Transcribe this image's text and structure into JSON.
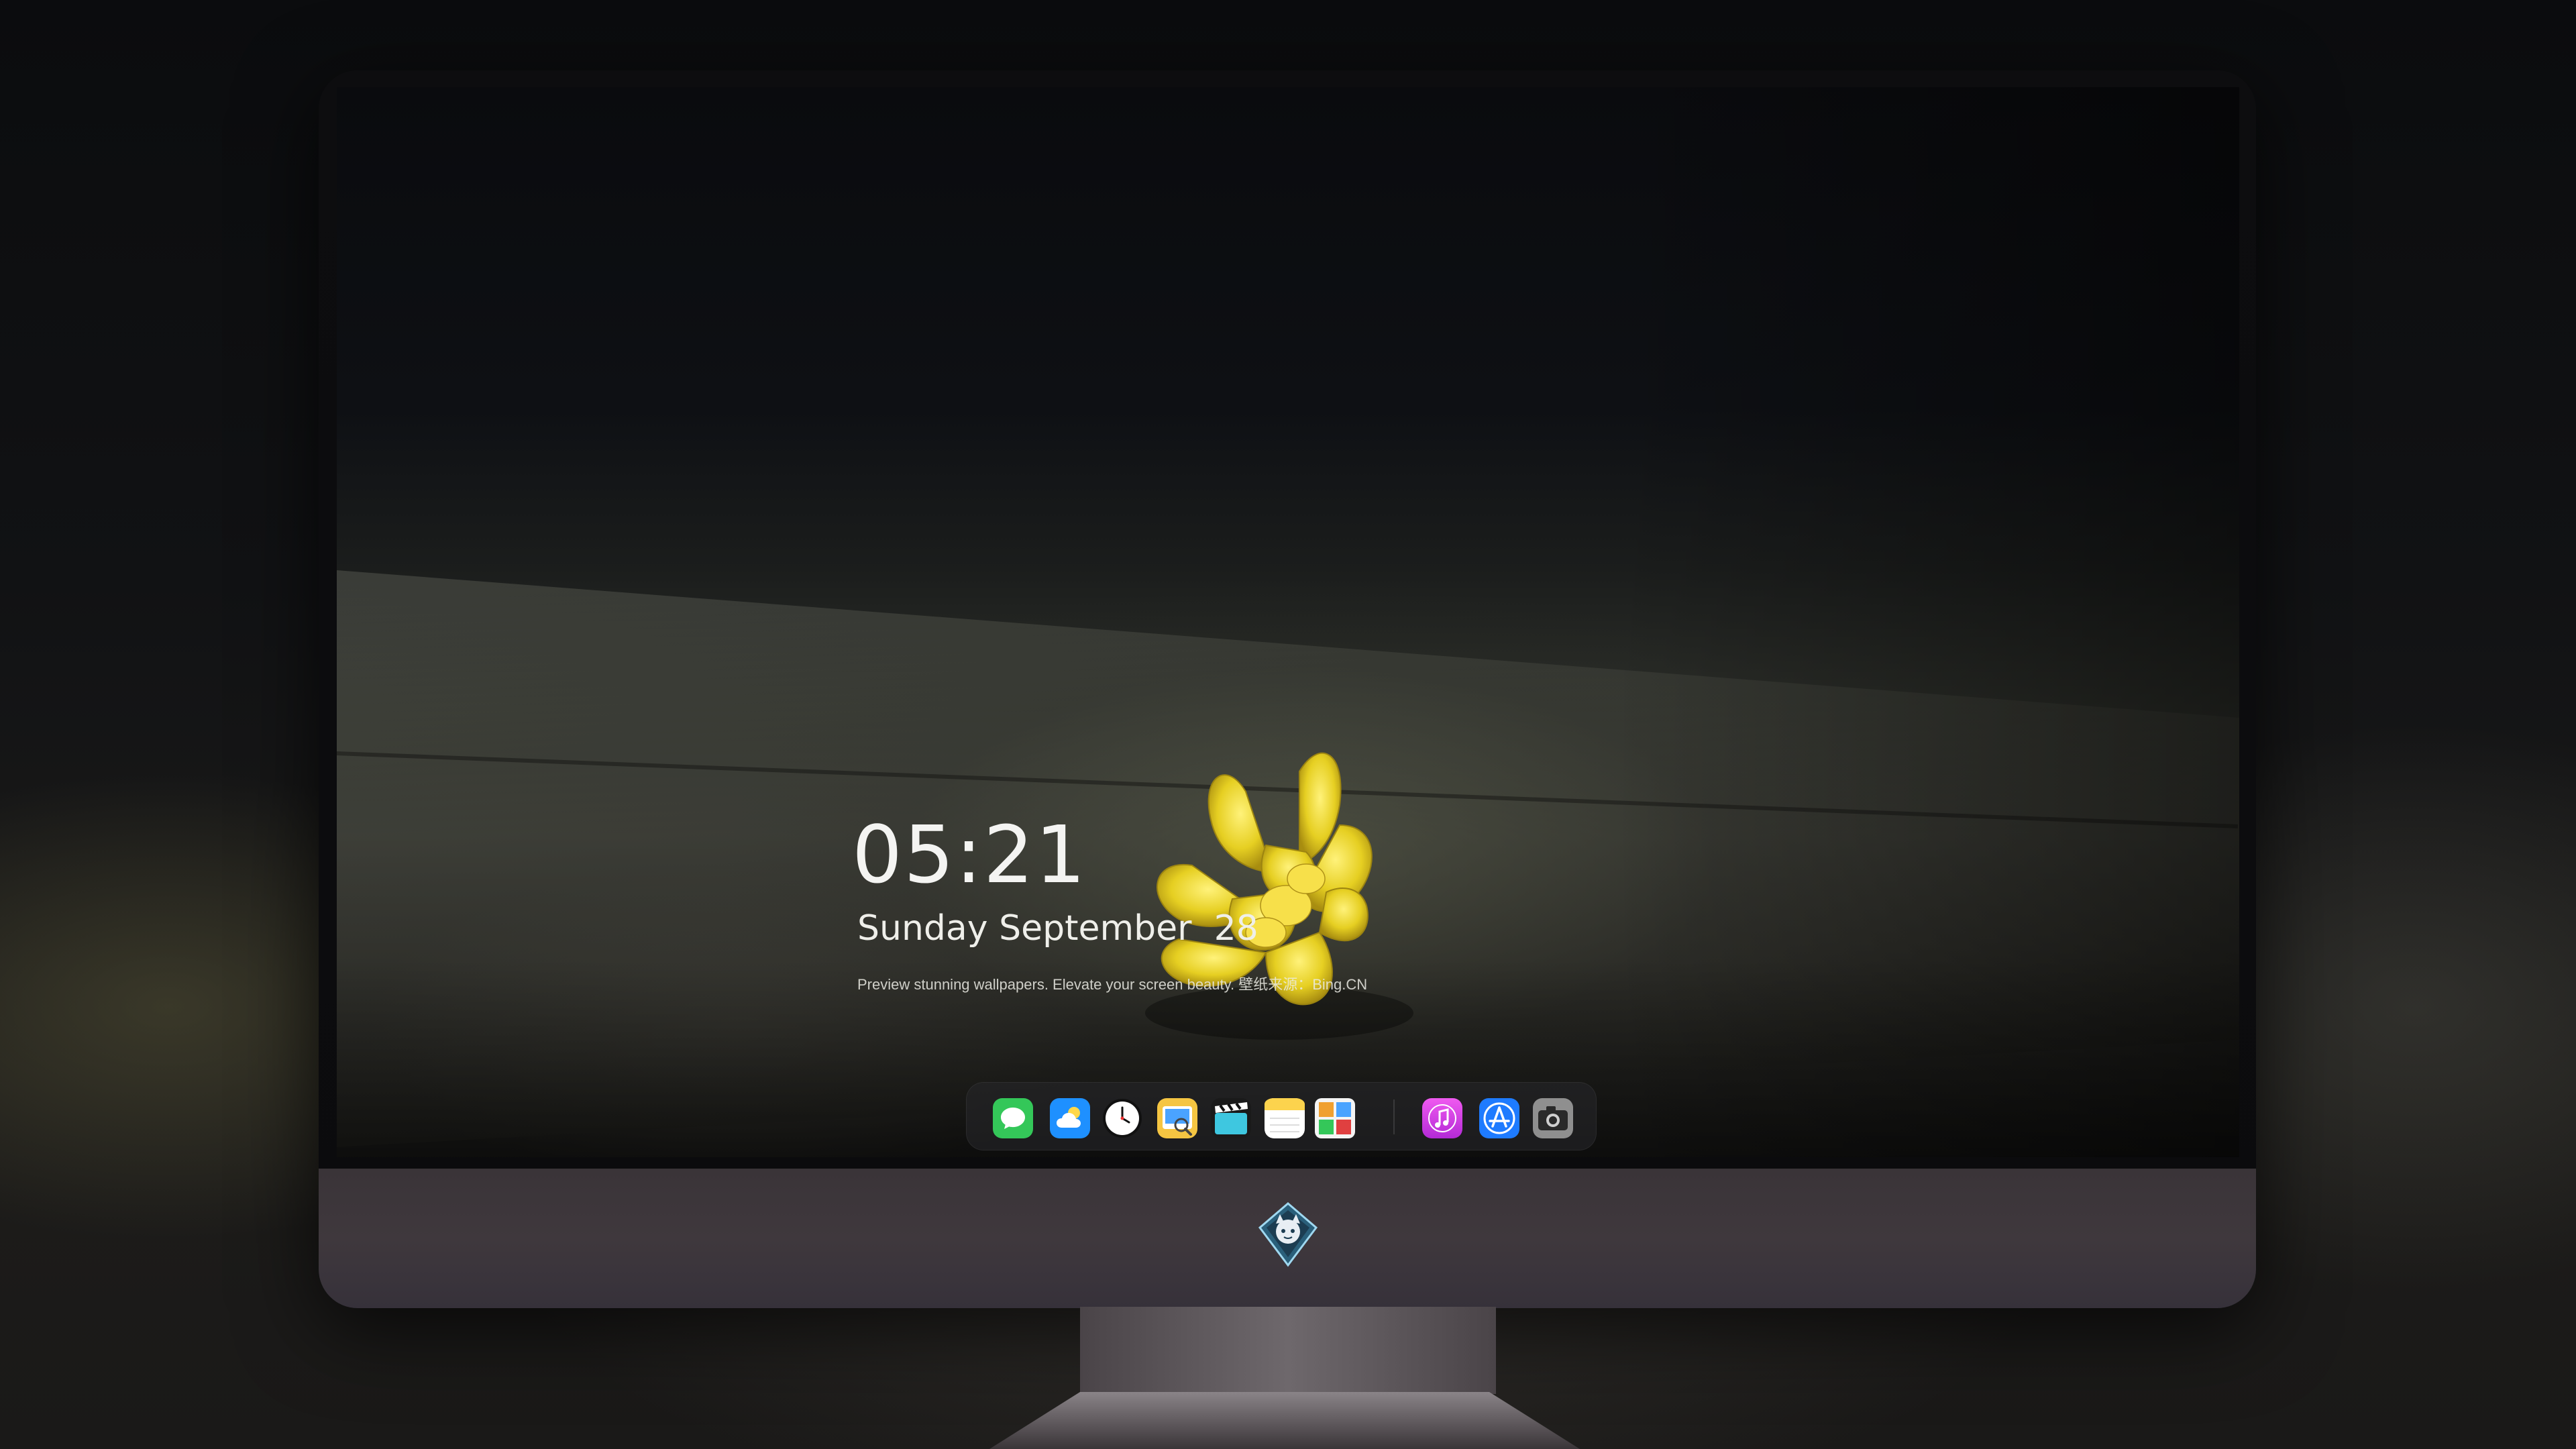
{
  "lock_screen": {
    "time": "05:21",
    "date": "Sunday September  28",
    "caption": "Preview stunning wallpapers. Elevate your screen beauty. 壁纸来源：Bing.CN"
  },
  "dock": {
    "apps": [
      {
        "name": "messages-icon",
        "color": "#34c759"
      },
      {
        "name": "weather-icon",
        "color": "#1e90ff"
      },
      {
        "name": "clock-icon",
        "color": "#ffffff"
      },
      {
        "name": "preview-icon",
        "color": "#f5c542"
      },
      {
        "name": "video-clapper-icon",
        "color": "#3ec7e0"
      },
      {
        "name": "notes-icon",
        "color": "#fcd34d"
      },
      {
        "name": "photo-collage-icon",
        "color": "#f0a030"
      },
      {
        "name": "music-icon",
        "color": "#d63ad9"
      },
      {
        "name": "app-store-icon",
        "color": "#1e7bff"
      },
      {
        "name": "camera-icon",
        "color": "#9a9a9a"
      }
    ]
  }
}
